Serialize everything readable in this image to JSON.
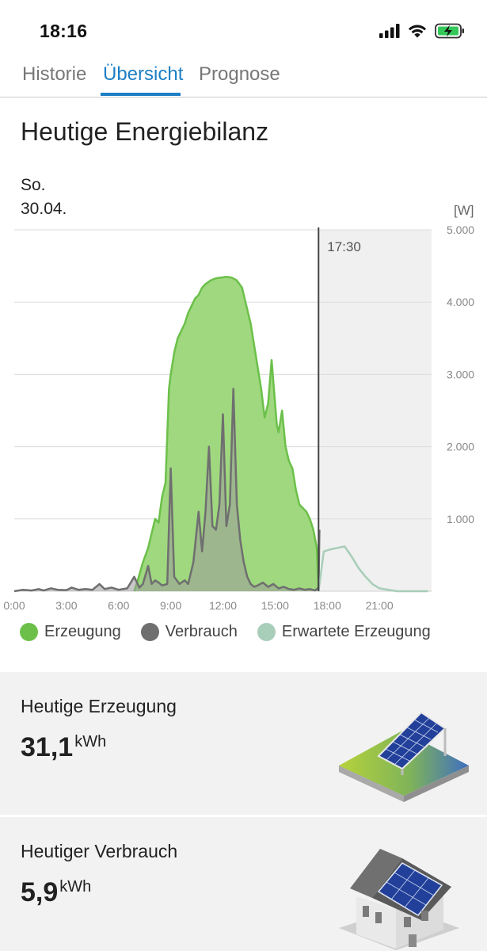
{
  "status": {
    "time": "18:16"
  },
  "tabs": [
    {
      "label": "Historie",
      "active": false
    },
    {
      "label": "Übersicht",
      "active": true
    },
    {
      "label": "Prognose",
      "active": false
    }
  ],
  "title": "Heutige Energiebilanz",
  "date": {
    "day": "So.",
    "date": "30.04."
  },
  "colors": {
    "accent": "#1e7fc4",
    "production": "#6cc04a",
    "production_fill": "#9fd87f",
    "consumption": "#6f6f6f",
    "forecast": "#a8cdb8"
  },
  "chart_data": {
    "type": "area",
    "unit_label": "[W]",
    "current_time_label": "17:30",
    "x_unit": "hour",
    "xlim": [
      0,
      24
    ],
    "ylim": [
      0,
      5000
    ],
    "x_ticks": [
      {
        "value": 0,
        "label": "0:00"
      },
      {
        "value": 3,
        "label": "3:00"
      },
      {
        "value": 6,
        "label": "6:00"
      },
      {
        "value": 9,
        "label": "9:00"
      },
      {
        "value": 12,
        "label": "12:00"
      },
      {
        "value": 15,
        "label": "15:00"
      },
      {
        "value": 18,
        "label": "18:00"
      },
      {
        "value": 21,
        "label": "21:00"
      }
    ],
    "y_ticks": [
      {
        "value": 1000,
        "label": "1.000"
      },
      {
        "value": 2000,
        "label": "2.000"
      },
      {
        "value": 3000,
        "label": "3.000"
      },
      {
        "value": 4000,
        "label": "4.000"
      },
      {
        "value": 5000,
        "label": "5.000"
      }
    ],
    "grid": true,
    "series": [
      {
        "name": "Erzeugung",
        "x": [
          6.9,
          7.1,
          7.4,
          7.7,
          7.9,
          8.1,
          8.3,
          8.5,
          8.7,
          8.9,
          9.0,
          9.2,
          9.4,
          9.6,
          9.8,
          10.0,
          10.2,
          10.4,
          10.6,
          10.8,
          11.0,
          11.3,
          11.6,
          11.9,
          12.2,
          12.5,
          12.8,
          13.1,
          13.3,
          13.6,
          13.8,
          14.0,
          14.2,
          14.4,
          14.6,
          14.8,
          14.9,
          15.1,
          15.2,
          15.4,
          15.6,
          15.7,
          15.8,
          16.0,
          16.2,
          16.4,
          16.6,
          16.8,
          17.0,
          17.2,
          17.4,
          17.5
        ],
        "y": [
          0,
          150,
          400,
          600,
          800,
          1000,
          950,
          1300,
          1500,
          2800,
          3000,
          3300,
          3500,
          3600,
          3700,
          3850,
          3950,
          4050,
          4100,
          4200,
          4250,
          4300,
          4330,
          4340,
          4350,
          4340,
          4300,
          4200,
          4000,
          3700,
          3400,
          3100,
          2800,
          2400,
          2600,
          3200,
          2900,
          2300,
          2200,
          2500,
          2000,
          1900,
          1800,
          1700,
          1400,
          1200,
          1150,
          1100,
          1000,
          850,
          600,
          0
        ]
      },
      {
        "name": "Verbrauch",
        "x": [
          0,
          0.5,
          1.0,
          1.4,
          1.7,
          2.1,
          2.5,
          3.0,
          3.3,
          3.7,
          4.1,
          4.5,
          4.9,
          5.2,
          5.6,
          6.0,
          6.5,
          6.9,
          7.2,
          7.4,
          7.7,
          7.9,
          8.1,
          8.3,
          8.5,
          8.8,
          9.0,
          9.2,
          9.5,
          9.8,
          10.0,
          10.3,
          10.6,
          10.8,
          11.0,
          11.2,
          11.4,
          11.6,
          11.8,
          12.0,
          12.2,
          12.4,
          12.6,
          12.8,
          13.0,
          13.2,
          13.4,
          13.6,
          13.8,
          14.0,
          14.3,
          14.6,
          14.9,
          15.2,
          15.5,
          15.8,
          16.1,
          16.4,
          16.7,
          17.0,
          17.3,
          17.5,
          17.55
        ],
        "y": [
          0,
          20,
          10,
          30,
          10,
          40,
          20,
          15,
          50,
          20,
          30,
          20,
          100,
          30,
          50,
          20,
          40,
          200,
          50,
          100,
          350,
          100,
          150,
          120,
          80,
          100,
          1700,
          200,
          100,
          150,
          100,
          400,
          1100,
          550,
          1100,
          2000,
          900,
          850,
          1200,
          2450,
          900,
          1200,
          2800,
          1200,
          700,
          400,
          200,
          100,
          60,
          80,
          120,
          60,
          100,
          40,
          60,
          30,
          20,
          40,
          20,
          30,
          10,
          50,
          850
        ]
      },
      {
        "name": "Erwartete Erzeugung",
        "x": [
          17.5,
          17.8,
          18.2,
          18.6,
          19.0,
          19.4,
          19.8,
          20.2,
          20.6,
          21.0,
          22.0,
          23.0,
          23.8
        ],
        "y": [
          0,
          550,
          580,
          600,
          620,
          480,
          320,
          200,
          100,
          40,
          0,
          0,
          0
        ]
      }
    ]
  },
  "legend": [
    {
      "label": "Erzeugung"
    },
    {
      "label": "Verbrauch"
    },
    {
      "label": "Erwartete Erzeugung"
    }
  ],
  "cards": [
    {
      "title": "Heutige Erzeugung",
      "value": "31,1",
      "unit": "kWh",
      "icon": "solar-panel-icon"
    },
    {
      "title": "Heutiger Verbrauch",
      "value": "5,9",
      "unit": "kWh",
      "icon": "house-solar-icon"
    }
  ]
}
